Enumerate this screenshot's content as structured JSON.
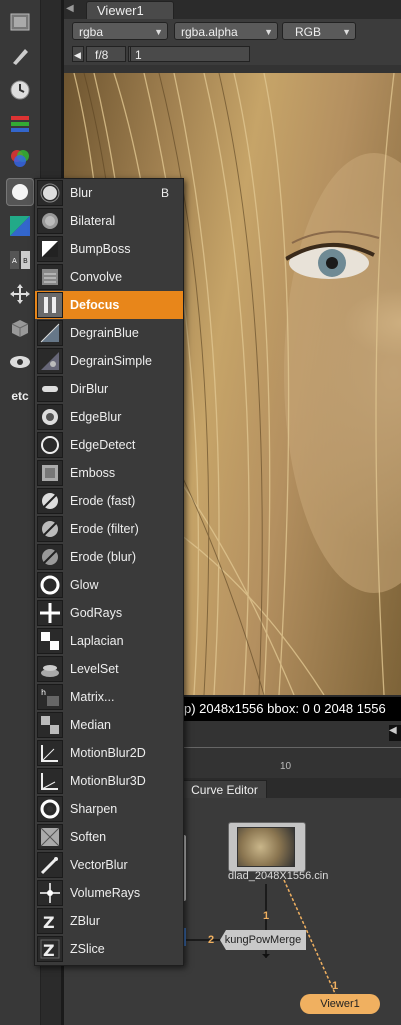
{
  "viewer": {
    "tab_label": "Viewer1",
    "channel_dropdown": "rgba",
    "alpha_dropdown": "rgba.alpha",
    "display_dropdown": "RGB",
    "fstop": "f/8",
    "frame_field": "1",
    "status_text": "p) 2048x1556 bbox: 0 0 2048 1556",
    "timeline_label": "10"
  },
  "node_graph": {
    "tab_label": "Curve Editor",
    "read_node_label": "dlad_2048X1556.cin",
    "merge_node_label": "kungPowMerge",
    "viewer_node_label": "Viewer1",
    "input_1": "1",
    "input_2": "2",
    "input_viewer": "1"
  },
  "toolbar": {
    "items": [
      "image-icon",
      "draw-icon",
      "time-icon",
      "channel-icon",
      "color-icon",
      "filter-icon",
      "keyer-icon",
      "merge-icon",
      "transform-icon",
      "3d-icon",
      "views-icon",
      "other-icon"
    ],
    "other_label": "etc"
  },
  "menu": {
    "items": [
      {
        "label": "Blur",
        "shortcut": "B"
      },
      {
        "label": "Bilateral"
      },
      {
        "label": "BumpBoss"
      },
      {
        "label": "Convolve"
      },
      {
        "label": "Defocus",
        "highlighted": true
      },
      {
        "label": "DegrainBlue"
      },
      {
        "label": "DegrainSimple"
      },
      {
        "label": "DirBlur"
      },
      {
        "label": "EdgeBlur"
      },
      {
        "label": "EdgeDetect"
      },
      {
        "label": "Emboss"
      },
      {
        "label": "Erode (fast)"
      },
      {
        "label": "Erode (filter)"
      },
      {
        "label": "Erode (blur)"
      },
      {
        "label": "Glow"
      },
      {
        "label": "GodRays"
      },
      {
        "label": "Laplacian"
      },
      {
        "label": "LevelSet"
      },
      {
        "label": "Matrix..."
      },
      {
        "label": "Median"
      },
      {
        "label": "MotionBlur2D"
      },
      {
        "label": "MotionBlur3D"
      },
      {
        "label": "Sharpen"
      },
      {
        "label": "Soften"
      },
      {
        "label": "VectorBlur"
      },
      {
        "label": "VolumeRays"
      },
      {
        "label": "ZBlur"
      },
      {
        "label": "ZSlice"
      }
    ]
  },
  "colors": {
    "highlight": "#e8861a",
    "viewer_node": "#f0b060",
    "panel_bg": "#3a3a3a"
  }
}
